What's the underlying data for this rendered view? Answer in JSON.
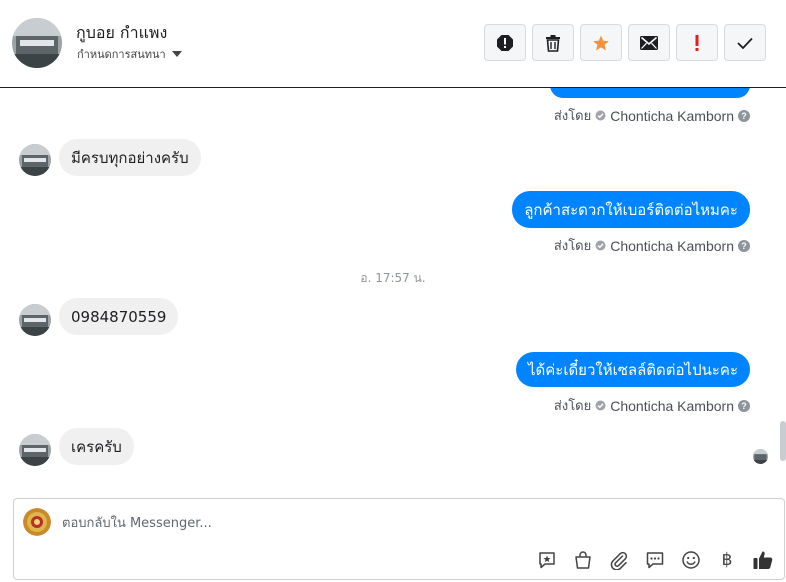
{
  "header": {
    "contact_name": "กูบอย กำแพง",
    "subtitle": "กำหนดการสนทนา",
    "actions": [
      {
        "name": "report-icon",
        "label": "!"
      },
      {
        "name": "trash-icon"
      },
      {
        "name": "star-icon",
        "color": "#f7923a"
      },
      {
        "name": "mail-icon"
      },
      {
        "name": "priority-icon",
        "label": "!",
        "color": "#e02020"
      },
      {
        "name": "check-icon"
      }
    ]
  },
  "thread": {
    "messages": [
      {
        "direction": "out",
        "text": ""
      },
      {
        "direction": "in",
        "text": "มีครบทุกอย่างครับ"
      },
      {
        "direction": "out",
        "text": "ลูกค้าสะดวกให้เบอร์ติดต่อไหมคะ"
      },
      {
        "direction": "in",
        "text": "0984870559"
      },
      {
        "direction": "out",
        "text": "ได้ค่ะเดี๋ยวให้เซลล์ติดต่อไปนะคะ"
      },
      {
        "direction": "in",
        "text": "เครครับ"
      }
    ],
    "sent_by_label": "ส่งโดย",
    "agent_name": "Chonticha Kamborn",
    "help_glyph": "?",
    "timestamp": "อ. 17:57 น."
  },
  "composer": {
    "placeholder": "ตอบกลับใน Messenger...",
    "tools": [
      "saved-reply-icon",
      "shop-icon",
      "attachment-icon",
      "chat-icon",
      "emoji-icon",
      "currency-icon",
      "like-icon"
    ],
    "currency_glyph": "฿"
  },
  "colors": {
    "accent": "#0084ff",
    "bubble_in": "#f1f0f0",
    "muted": "#4b4f56"
  }
}
